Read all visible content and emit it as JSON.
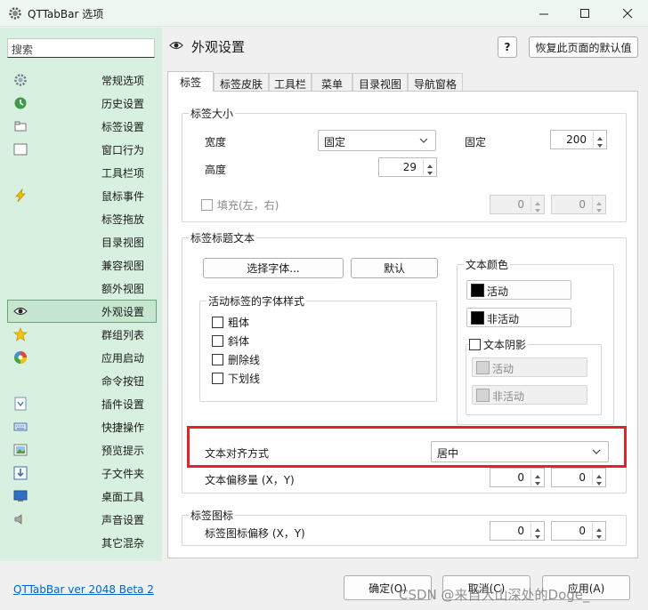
{
  "window": {
    "title": "QTTabBar 选项",
    "controls": {
      "minimize": "minimize-icon",
      "maximize": "maximize-icon",
      "close": "close-icon"
    }
  },
  "sidebar": {
    "search_placeholder": "搜索",
    "items": [
      {
        "label": "常规选项",
        "icon": "gear-icon"
      },
      {
        "label": "历史设置",
        "icon": "history-icon"
      },
      {
        "label": "标签设置",
        "icon": "tab-icon"
      },
      {
        "label": "窗口行为",
        "icon": "window-icon"
      },
      {
        "label": "工具栏项",
        "icon": ""
      },
      {
        "label": "鼠标事件",
        "icon": "lightning-icon"
      },
      {
        "label": "标签拖放",
        "icon": ""
      },
      {
        "label": "目录视图",
        "icon": ""
      },
      {
        "label": "兼容视图",
        "icon": ""
      },
      {
        "label": "额外视图",
        "icon": ""
      },
      {
        "label": "外观设置",
        "icon": "eye-icon"
      },
      {
        "label": "群组列表",
        "icon": "star-icon"
      },
      {
        "label": "应用启动",
        "icon": "app-launch-icon"
      },
      {
        "label": "命令按钮",
        "icon": ""
      },
      {
        "label": "插件设置",
        "icon": "plugin-icon"
      },
      {
        "label": "快捷操作",
        "icon": "keyboard-icon"
      },
      {
        "label": "预览提示",
        "icon": "preview-icon"
      },
      {
        "label": "子文件夹",
        "icon": "subfolder-icon"
      },
      {
        "label": "桌面工具",
        "icon": "desktop-icon"
      },
      {
        "label": "声音设置",
        "icon": "speaker-icon"
      },
      {
        "label": "其它混杂",
        "icon": ""
      }
    ],
    "selected": "外观设置"
  },
  "header": {
    "title": "外观设置",
    "help_label": "?",
    "restore_label": "恢复此页面的默认值"
  },
  "tabs": [
    {
      "label": "标签",
      "active": true
    },
    {
      "label": "标签皮肤",
      "active": false
    },
    {
      "label": "工具栏",
      "active": false
    },
    {
      "label": "菜单",
      "active": false
    },
    {
      "label": "目录视图",
      "active": false
    },
    {
      "label": "导航窗格",
      "active": false
    }
  ],
  "tab_size": {
    "title": "标签大小",
    "width_label": "宽度",
    "width_mode": "固定",
    "fixed_label": "固定",
    "fixed_value": "200",
    "height_label": "高度",
    "height_value": "29",
    "fill_label": "填充(左，右)",
    "fill_left": "0",
    "fill_right": "0"
  },
  "title_text": {
    "title": "标签标题文本",
    "choose_font_label": "选择字体...",
    "default_label": "默认",
    "active_font_style": {
      "title": "活动标签的字体样式",
      "bold": "粗体",
      "italic": "斜体",
      "strikethrough": "删除线",
      "underline": "下划线"
    },
    "text_color": {
      "title": "文本颜色",
      "active": "活动",
      "inactive": "非活动",
      "swatch_color": "#000000"
    },
    "text_shadow": {
      "title": "文本阴影",
      "active": "活动",
      "inactive": "非活动"
    },
    "align_label": "文本对齐方式",
    "align_value": "居中",
    "offset_label": "文本偏移量 (X，Y)",
    "offset_x": "0",
    "offset_y": "0"
  },
  "tab_icon": {
    "title": "标签图标",
    "offset_label": "标签图标偏移 (X，Y)",
    "offset_x": "0",
    "offset_y": "0"
  },
  "footer": {
    "version": "QTTabBar ver 2048 Beta 2",
    "ok": "确定(O)",
    "cancel": "取消(C)",
    "apply": "应用(A)",
    "watermark": "CSDN @来自大山深处的Doge_"
  },
  "colors": {
    "sidebar_bg": "#d8f0df",
    "highlight_border": "#e0242d",
    "link": "#0066cc"
  }
}
